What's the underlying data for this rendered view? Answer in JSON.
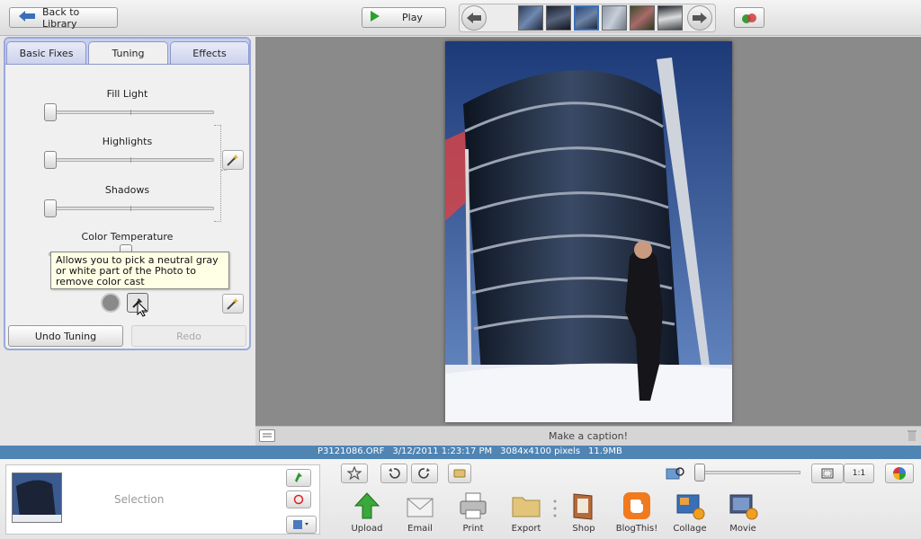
{
  "topbar": {
    "back_label": "Back to Library",
    "play_label": "Play"
  },
  "tabs": [
    {
      "label": "Basic Fixes"
    },
    {
      "label": "Tuning"
    },
    {
      "label": "Effects"
    }
  ],
  "sliders": {
    "fill_light": "Fill Light",
    "highlights": "Highlights",
    "shadows": "Shadows",
    "color_temperature": "Color Temperature"
  },
  "tooltip": "Allows you to pick a neutral gray or white part of the Photo to remove color cast",
  "buttons": {
    "undo": "Undo Tuning",
    "redo": "Redo"
  },
  "caption_placeholder": "Make a caption!",
  "status": {
    "filename": "P3121086.ORF",
    "datetime": "3/12/2011 1:23:17 PM",
    "dimensions": "3084x4100 pixels",
    "filesize": "11.9MB"
  },
  "tray": {
    "selection_label": "Selection",
    "one_to_one": "1:1",
    "actions": [
      {
        "label": "Upload"
      },
      {
        "label": "Email"
      },
      {
        "label": "Print"
      },
      {
        "label": "Export"
      },
      {
        "label": "Shop"
      },
      {
        "label": "BlogThis!"
      },
      {
        "label": "Collage"
      },
      {
        "label": "Movie"
      }
    ]
  }
}
